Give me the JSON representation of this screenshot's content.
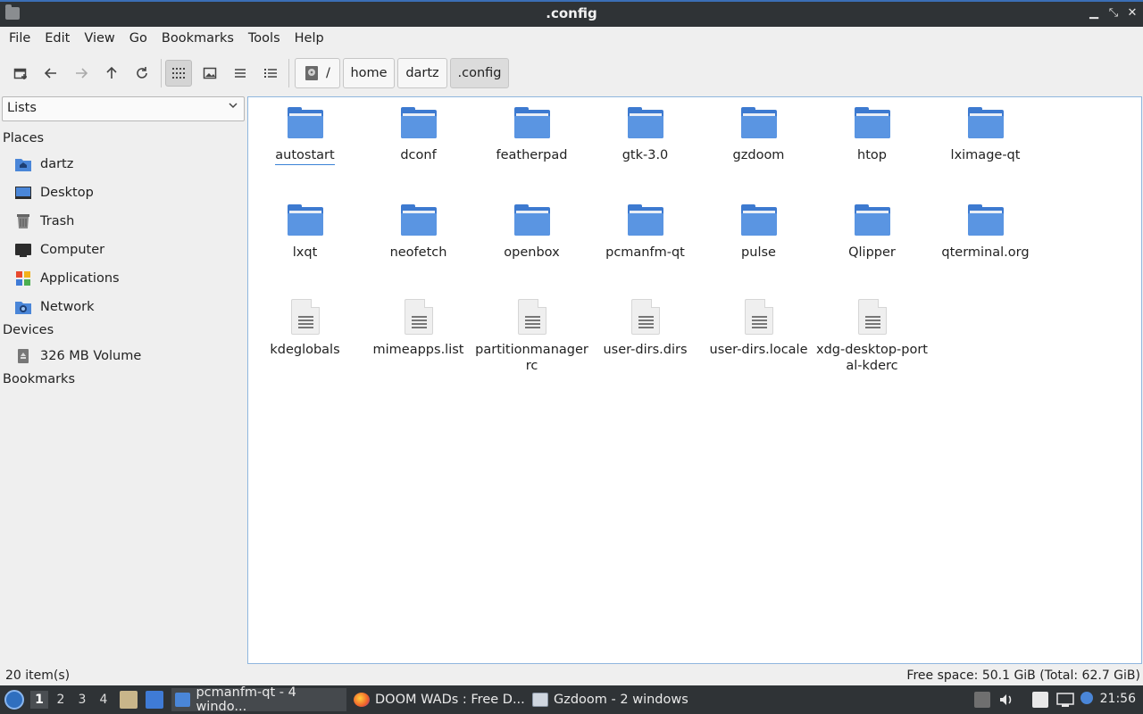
{
  "window": {
    "title": ".config"
  },
  "menu": [
    "File",
    "Edit",
    "View",
    "Go",
    "Bookmarks",
    "Tools",
    "Help"
  ],
  "breadcrumb": {
    "root": "/",
    "parts": [
      "home",
      "dartz",
      ".config"
    ]
  },
  "sidebar": {
    "mode": "Lists",
    "places_heading": "Places",
    "places": [
      {
        "label": "dartz",
        "icon": "home-folder-icon"
      },
      {
        "label": "Desktop",
        "icon": "desktop-icon"
      },
      {
        "label": "Trash",
        "icon": "trash-icon"
      },
      {
        "label": "Computer",
        "icon": "computer-icon"
      },
      {
        "label": "Applications",
        "icon": "applications-icon"
      },
      {
        "label": "Network",
        "icon": "network-icon"
      }
    ],
    "devices_heading": "Devices",
    "devices": [
      {
        "label": "326 MB Volume",
        "icon": "drive-icon"
      }
    ],
    "bookmarks_heading": "Bookmarks"
  },
  "files": [
    {
      "name": "autostart",
      "type": "folder"
    },
    {
      "name": "dconf",
      "type": "folder"
    },
    {
      "name": "featherpad",
      "type": "folder"
    },
    {
      "name": "gtk-3.0",
      "type": "folder"
    },
    {
      "name": "gzdoom",
      "type": "folder"
    },
    {
      "name": "htop",
      "type": "folder"
    },
    {
      "name": "lximage-qt",
      "type": "folder"
    },
    {
      "name": "lxqt",
      "type": "folder"
    },
    {
      "name": "neofetch",
      "type": "folder"
    },
    {
      "name": "openbox",
      "type": "folder"
    },
    {
      "name": "pcmanfm-qt",
      "type": "folder"
    },
    {
      "name": "pulse",
      "type": "folder"
    },
    {
      "name": "Qlipper",
      "type": "folder"
    },
    {
      "name": "qterminal.org",
      "type": "folder"
    },
    {
      "name": "kdeglobals",
      "type": "file"
    },
    {
      "name": "mimeapps.list",
      "type": "file"
    },
    {
      "name": "partitionmanagerrc",
      "type": "file"
    },
    {
      "name": "user-dirs.dirs",
      "type": "file"
    },
    {
      "name": "user-dirs.locale",
      "type": "file"
    },
    {
      "name": "xdg-desktop-portal-kderc",
      "type": "file"
    }
  ],
  "status": {
    "items": "20 item(s)",
    "space": "Free space: 50.1 GiB (Total: 62.7 GiB)"
  },
  "taskbar": {
    "workspaces": [
      "1",
      "2",
      "3",
      "4"
    ],
    "tasks": [
      {
        "label": "pcmanfm-qt - 4 windo...",
        "icon": "folder-icon",
        "active": true
      },
      {
        "label": "DOOM WADs : Free D...",
        "icon": "firefox-icon",
        "active": false
      },
      {
        "label": "Gzdoom - 2 windows",
        "icon": "window-icon",
        "active": false
      }
    ],
    "clock": "21:56"
  },
  "colors": {
    "accent": "#3b83d6",
    "folder": "#4a86d8",
    "taskbar": "#2f3336"
  }
}
